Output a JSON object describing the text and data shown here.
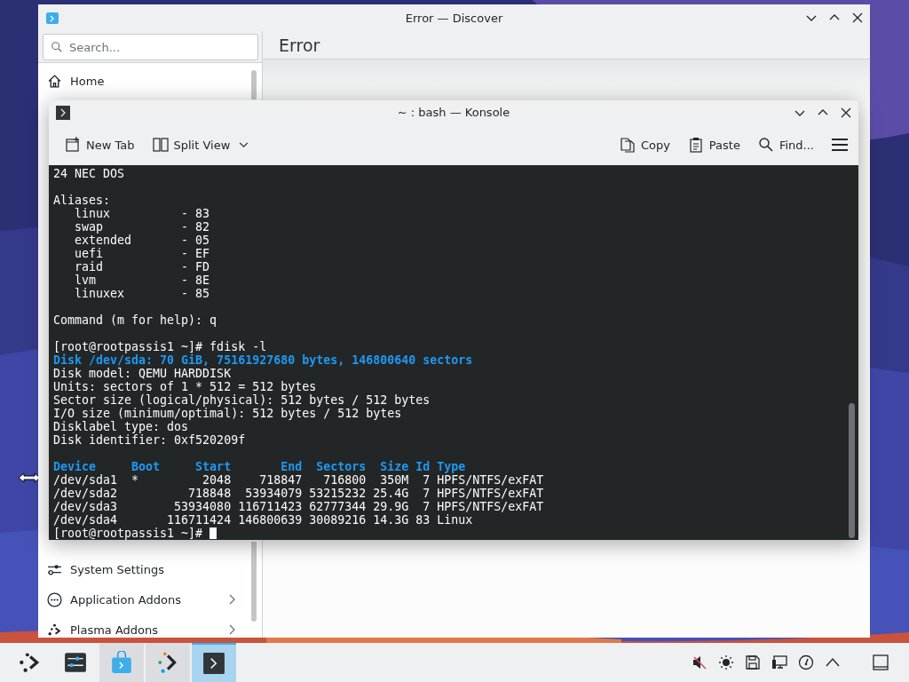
{
  "discover": {
    "title": "Error — Discover",
    "search": {
      "placeholder": "Search..."
    },
    "header": "Error",
    "sidebar_top": [
      {
        "label": "Home",
        "expandable": false
      }
    ],
    "sidebar_bottom": [
      {
        "label": "System Settings",
        "expandable": false
      },
      {
        "label": "Application Addons",
        "expandable": true
      },
      {
        "label": "Plasma Addons",
        "expandable": true
      }
    ]
  },
  "konsole": {
    "title": "~ : bash — Konsole",
    "toolbar_left": [
      {
        "label": "New Tab",
        "dropdown": false
      },
      {
        "label": "Split View",
        "dropdown": true
      }
    ],
    "toolbar_right": [
      {
        "label": "Copy"
      },
      {
        "label": "Paste"
      },
      {
        "label": "Find..."
      }
    ],
    "lines": [
      {
        "text": "24 NEC DOS",
        "kind": "output"
      },
      {
        "kind": "blank"
      },
      {
        "text": "Aliases:",
        "kind": "output"
      },
      {
        "text": "   linux          - 83",
        "kind": "output"
      },
      {
        "text": "   swap           - 82",
        "kind": "output"
      },
      {
        "text": "   extended       - 05",
        "kind": "output"
      },
      {
        "text": "   uefi           - EF",
        "kind": "output"
      },
      {
        "text": "   raid           - FD",
        "kind": "output"
      },
      {
        "text": "   lvm            - 8E",
        "kind": "output"
      },
      {
        "text": "   linuxex        - 85",
        "kind": "output"
      },
      {
        "kind": "blank"
      },
      {
        "text": "Command (m for help): q",
        "kind": "output"
      },
      {
        "kind": "blank"
      },
      {
        "text": "[root@rootpassis1 ~]# fdisk -l",
        "kind": "output"
      },
      {
        "text": "Disk /dev/sda: 70 GiB, 75161927680 bytes, 146800640 sectors",
        "kind": "heading"
      },
      {
        "text": "Disk model: QEMU HARDDISK",
        "kind": "output"
      },
      {
        "text": "Units: sectors of 1 * 512 = 512 bytes",
        "kind": "output"
      },
      {
        "text": "Sector size (logical/physical): 512 bytes / 512 bytes",
        "kind": "output"
      },
      {
        "text": "I/O size (minimum/optimal): 512 bytes / 512 bytes",
        "kind": "output"
      },
      {
        "text": "Disklabel type: dos",
        "kind": "output"
      },
      {
        "text": "Disk identifier: 0xf520209f",
        "kind": "output"
      },
      {
        "kind": "blank"
      },
      {
        "text": "Device     Boot     Start       End  Sectors  Size Id Type",
        "kind": "heading"
      },
      {
        "text": "/dev/sda1  *         2048    718847   716800  350M  7 HPFS/NTFS/exFAT",
        "kind": "output"
      },
      {
        "text": "/dev/sda2          718848  53934079 53215232 25.4G  7 HPFS/NTFS/exFAT",
        "kind": "output"
      },
      {
        "text": "/dev/sda3        53934080 116711423 62777344 29.9G  7 HPFS/NTFS/exFAT",
        "kind": "output"
      },
      {
        "text": "/dev/sda4       116711424 146800639 30089216 14.3G 83 Linux",
        "kind": "output"
      },
      {
        "text": "[root@rootpassis1 ~]#",
        "kind": "prompt"
      }
    ]
  },
  "taskbar": {
    "tasks": [
      {
        "open": false,
        "selected": false
      },
      {
        "open": false,
        "selected": false
      },
      {
        "open": true,
        "selected": false
      },
      {
        "open": true,
        "selected": false
      },
      {
        "open": true,
        "selected": true
      }
    ]
  }
}
